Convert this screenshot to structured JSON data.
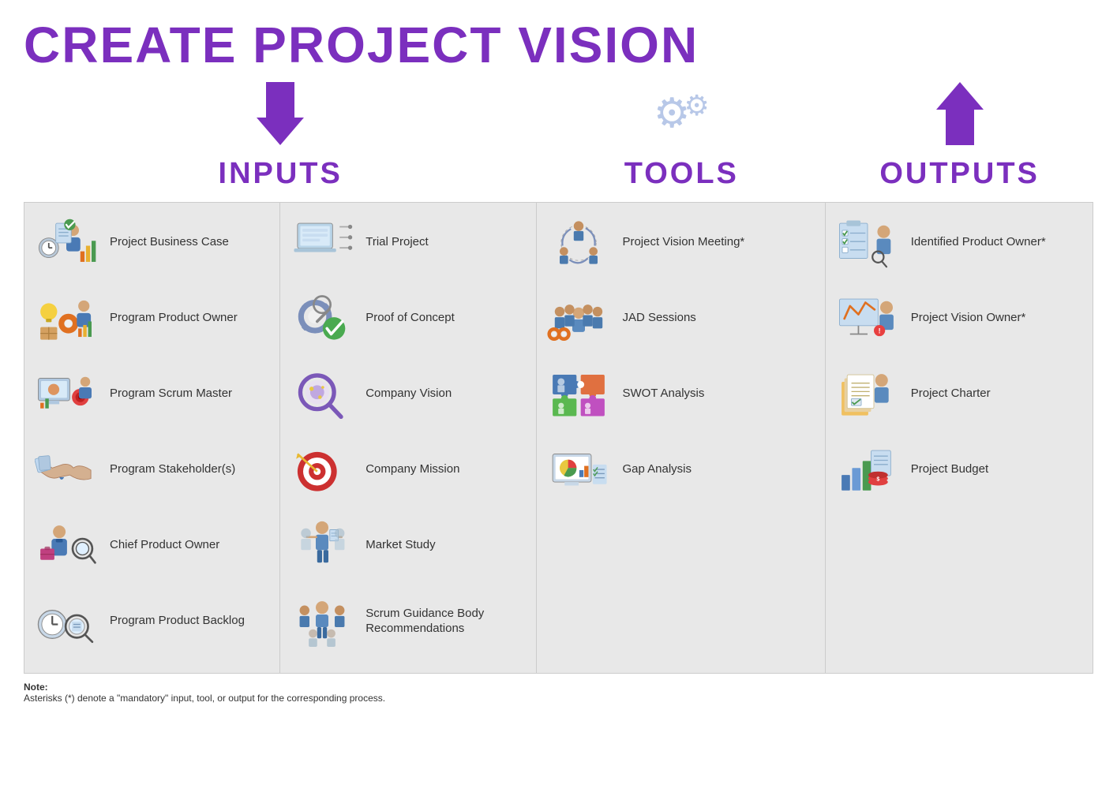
{
  "title": "CREATE PROJECT VISION",
  "sections": {
    "inputs": {
      "label": "INPUTS",
      "col1_items": [
        {
          "id": "project-business-case",
          "label": "Project Business Case"
        },
        {
          "id": "program-product-owner",
          "label": "Program Product Owner"
        },
        {
          "id": "program-scrum-master",
          "label": "Program Scrum Master"
        },
        {
          "id": "program-stakeholders",
          "label": "Program Stakeholder(s)"
        },
        {
          "id": "chief-product-owner",
          "label": "Chief Product Owner"
        },
        {
          "id": "program-product-backlog",
          "label": "Program Product Backlog"
        }
      ],
      "col2_items": [
        {
          "id": "trial-project",
          "label": "Trial Project"
        },
        {
          "id": "proof-of-concept",
          "label": "Proof of Concept"
        },
        {
          "id": "company-vision",
          "label": "Company Vision"
        },
        {
          "id": "company-mission",
          "label": "Company Mission"
        },
        {
          "id": "market-study",
          "label": "Market Study"
        },
        {
          "id": "scrum-guidance",
          "label": "Scrum Guidance Body Recommendations"
        }
      ]
    },
    "tools": {
      "label": "TOOLS",
      "items": [
        {
          "id": "project-vision-meeting",
          "label": "Project Vision Meeting*"
        },
        {
          "id": "jad-sessions",
          "label": "JAD Sessions"
        },
        {
          "id": "swot-analysis",
          "label": "SWOT Analysis"
        },
        {
          "id": "gap-analysis",
          "label": "Gap Analysis"
        }
      ]
    },
    "outputs": {
      "label": "OUTPUTS",
      "items": [
        {
          "id": "identified-product-owner",
          "label": "Identified Product Owner*"
        },
        {
          "id": "project-vision-owner",
          "label": "Project Vision Owner*"
        },
        {
          "id": "project-charter",
          "label": "Project Charter"
        },
        {
          "id": "project-budget",
          "label": "Project Budget"
        }
      ]
    }
  },
  "note": {
    "title": "Note:",
    "text": "Asterisks (*) denote a \"mandatory\" input, tool, or output for the corresponding process."
  }
}
